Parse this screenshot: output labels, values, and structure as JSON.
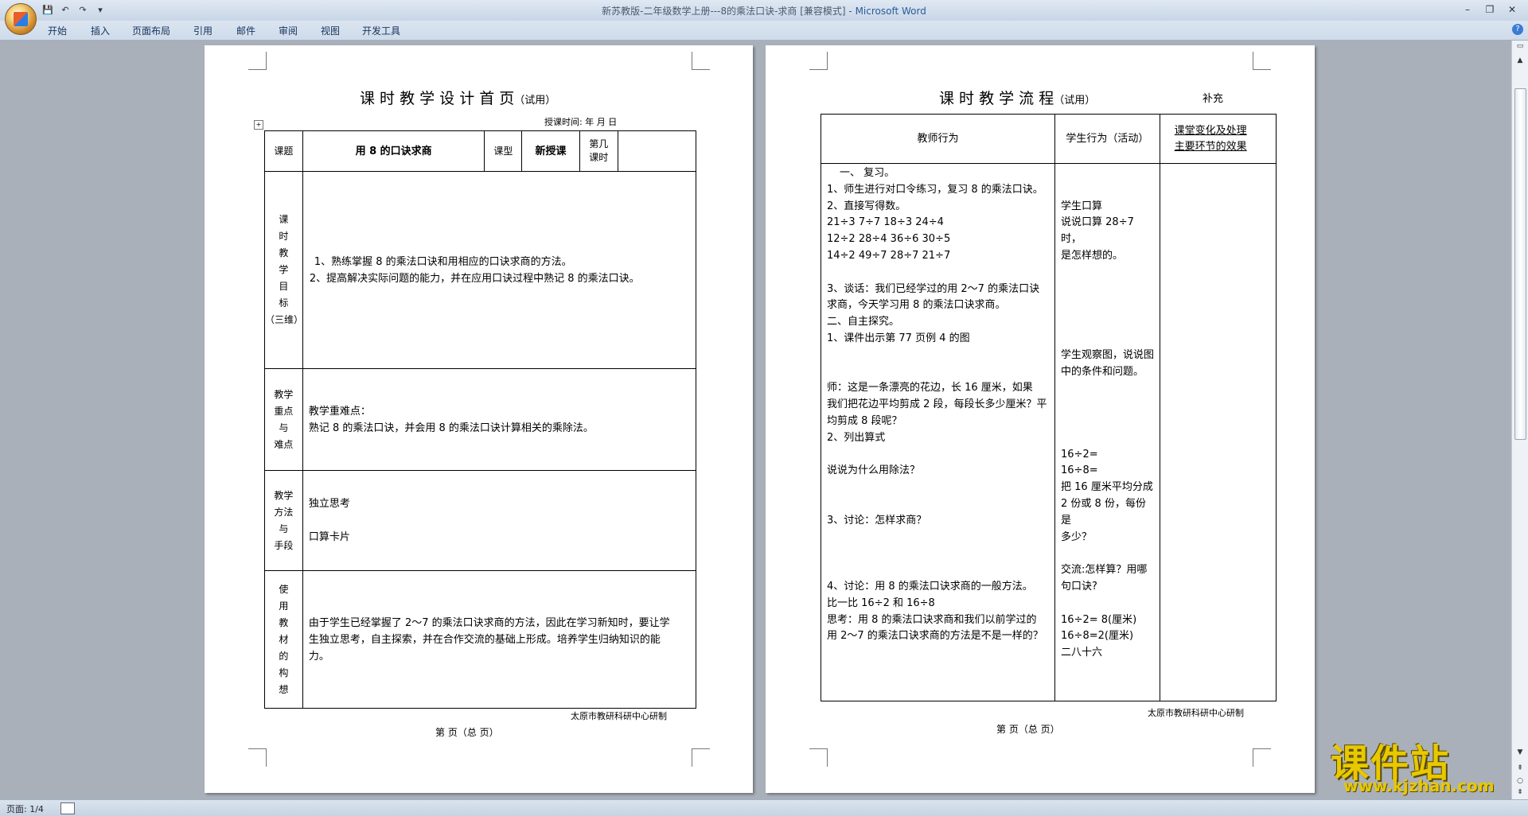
{
  "window": {
    "title": "新苏教版-二年级数学上册---8的乘法口诀-求商 [兼容模式] - ",
    "app": "Microsoft Word"
  },
  "ribbon": {
    "tabs": [
      "开始",
      "插入",
      "页面布局",
      "引用",
      "邮件",
      "审阅",
      "视图",
      "开发工具"
    ]
  },
  "status": {
    "page": "页面: 1/4"
  },
  "watermark": {
    "brand": "课件站",
    "url": "www.kjzhan.com"
  },
  "page1": {
    "title": "课 时 教 学 设 计 首 页",
    "title_suffix": "（试用）",
    "date_line": "授课时间:        年     月     日",
    "lesson_label": "课题",
    "lesson_value": "用 8 的口诀求商",
    "type_label": "课型",
    "type_value": "新授课",
    "period_label_1": "第几",
    "period_label_2": "课时",
    "goals_label": [
      "课",
      "时",
      "教",
      "学",
      "目",
      "标",
      "（三维）"
    ],
    "goals": [
      "1、熟练掌握 8 的乘法口诀和用相应的口诀求商的方法。",
      "2、提高解决实际问题的能力，并在应用口诀过程中熟记 8 的乘法口诀。"
    ],
    "key_label": [
      "教学",
      "重点",
      "与",
      "难点"
    ],
    "key_heading": "教学重难点：",
    "key_text": "熟记 8 的乘法口诀，并会用 8 的乘法口诀计算相关的乘除法。",
    "method_label": [
      "教学",
      "方法",
      "与",
      "手段"
    ],
    "methods": [
      "独立思考",
      "口算卡片"
    ],
    "use_label": [
      "使",
      "用",
      "教",
      "材",
      "的",
      "构",
      "想"
    ],
    "use_text": [
      "由于学生已经掌握了 2～7 的乘法口诀求商的方法，因此在学习新知时，要让学",
      "生独立思考，自主探索，并在合作交流的基础上形成。培养学生归纳知识的能",
      "力。"
    ],
    "footer": "太原市教研科研中心研制",
    "page_line": "第    页（总    页）"
  },
  "page2": {
    "title": "课 时 教 学 流 程",
    "title_suffix": "（试用）",
    "supplement": "补充",
    "col1": "教师行为",
    "col2": "学生行为（活动）",
    "col3_1": "课堂变化及处理",
    "col3_2": "主要环节的效果",
    "teacher": [
      "一、  复习。",
      "1、师生进行对口令练习，复习 8 的乘法口诀。",
      "2、直接写得数。",
      "21÷3    7÷7    18÷3    24÷4",
      "12÷2   28÷4    36÷6    30÷5",
      "14÷2   49÷7    28÷7    21÷7",
      "",
      "  3、谈话：我们已经学过的用 2～7 的乘法口诀",
      "求商，今天学习用 8 的乘法口诀求商。",
      "  二、自主探究。",
      "  1、课件出示第 77 页例 4 的图",
      "",
      "",
      "  师：这是一条漂亮的花边，长 16 厘米，如果",
      "我们把花边平均剪成 2 段，每段长多少厘米？平",
      "均剪成 8 段呢？",
      "  2、列出算式",
      "",
      "  说说为什么用除法？",
      "",
      "",
      "  3、讨论：怎样求商？",
      "",
      "",
      "",
      "  4、讨论：用 8 的乘法口诀求商的一般方法。",
      "  比一比 16÷2 和 16÷8",
      "  思考：用 8 的乘法口诀求商和我们以前学过的",
      "用 2～7 的乘法口诀求商的方法是不是一样的？"
    ],
    "student": [
      "",
      "",
      "学生口算",
      "说说口算 28÷7 时，",
      "是怎样想的。",
      "",
      "",
      "",
      "",
      "",
      "学生观察图，说说图",
      "中的条件和问题。",
      "",
      "",
      "",
      "",
      "16÷2=",
      "16÷8=",
      "把 16 厘米平均分成",
      "2 份或 8 份，每份是",
      "多少？",
      "",
      "交流:怎样算？用哪",
      "句口诀?",
      "",
      "16÷2= 8(厘米)",
      "16÷8=2(厘米)",
      "二八十六"
    ],
    "footer": "太原市教研科研中心研制",
    "page_line": "第    页（总    页）"
  }
}
